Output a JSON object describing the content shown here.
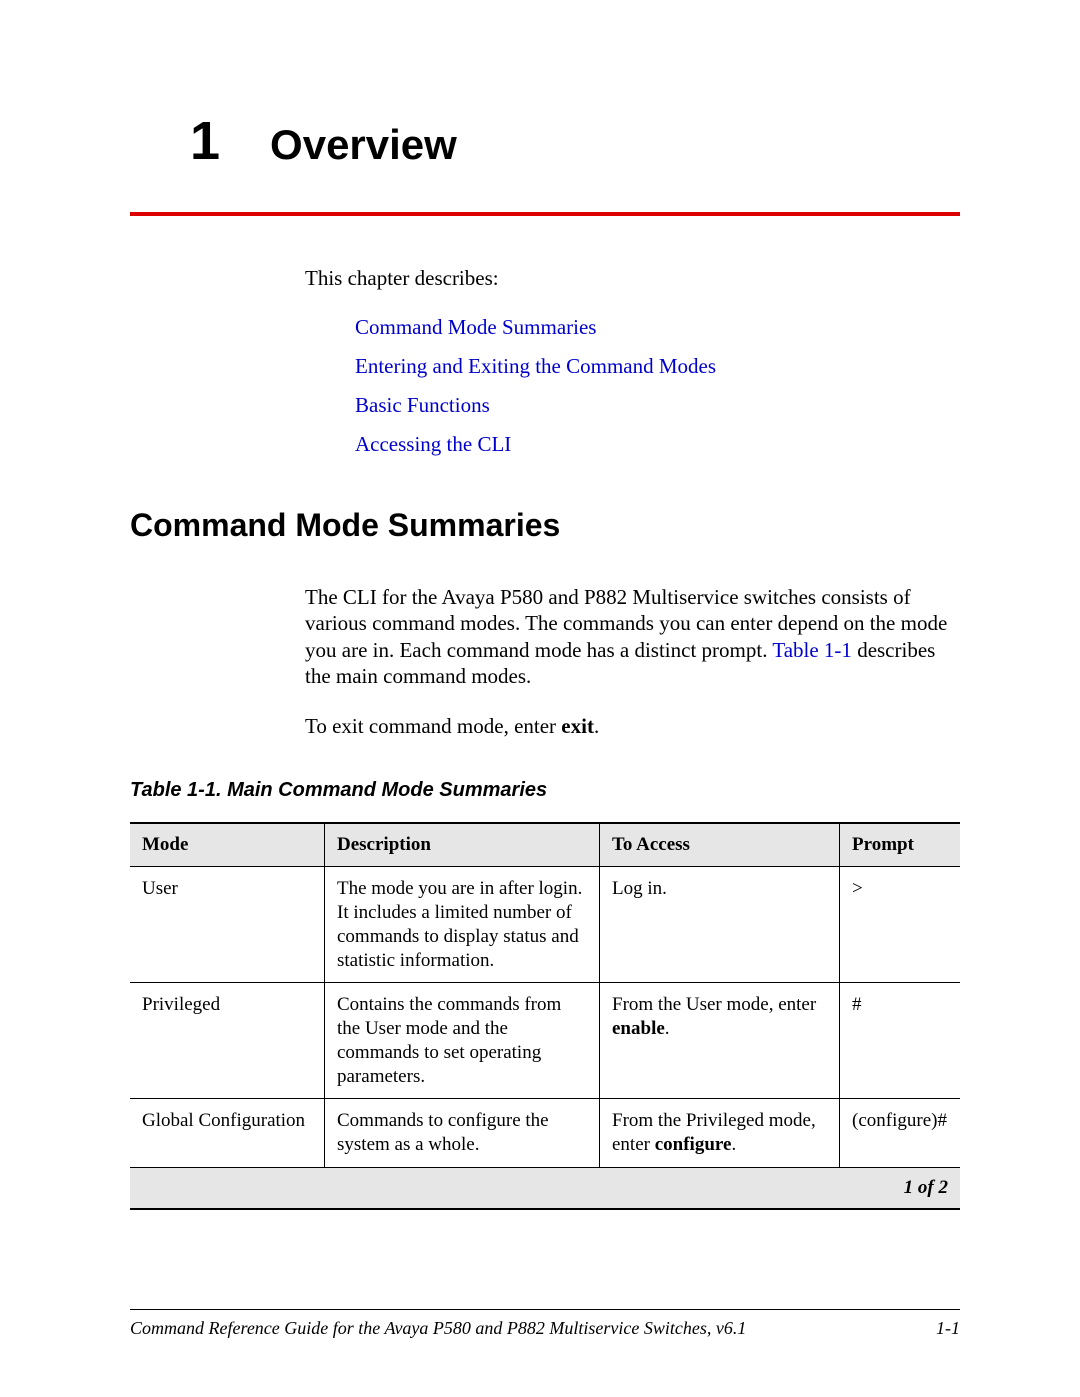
{
  "chapter": {
    "number": "1",
    "title": "Overview"
  },
  "intro": "This chapter describes:",
  "toc": [
    "Command Mode Summaries",
    "Entering and Exiting the Command Modes",
    "Basic Functions",
    "Accessing the CLI"
  ],
  "section_heading": "Command Mode Summaries",
  "para1_a": "The CLI for the Avaya P580 and P882 Multiservice switches consists of various command modes. The commands you can enter depend on the mode you are in. Each command mode has a distinct prompt. ",
  "para1_link": "Table 1-1",
  "para1_b": " describes the main command modes.",
  "para2_a": "To exit command mode, enter ",
  "para2_bold": "exit",
  "para2_b": ".",
  "table_caption": "Table 1-1. Main Command Mode Summaries",
  "table": {
    "headers": [
      "Mode",
      "Description",
      "To Access",
      "Prompt"
    ],
    "rows": [
      {
        "mode": "User",
        "desc": "The mode you are in after login. It includes a limited number of commands to display status and statistic information.",
        "access_a": "Log in.",
        "access_bold": "",
        "access_b": "",
        "prompt": ">"
      },
      {
        "mode": "Privileged",
        "desc": "Contains the commands from the User mode and the commands to set operating parameters.",
        "access_a": "From the User mode, enter ",
        "access_bold": "enable",
        "access_b": ".",
        "prompt": "#"
      },
      {
        "mode": "Global Configuration",
        "desc": "Commands to configure the system as a whole.",
        "access_a": "From the Privileged mode, enter ",
        "access_bold": "configure",
        "access_b": ".",
        "prompt": "(configure)#"
      }
    ],
    "pager": "1 of 2"
  },
  "footer": {
    "left": "Command Reference Guide for the Avaya P580 and P882 Multiservice Switches, v6.1",
    "right": "1-1"
  }
}
